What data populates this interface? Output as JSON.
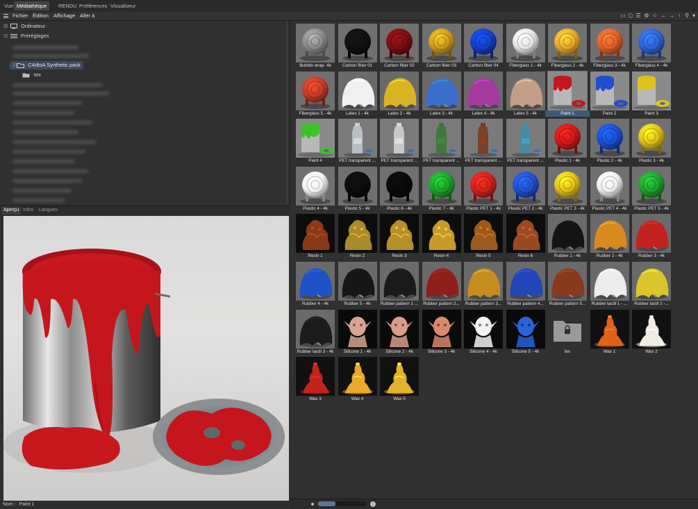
{
  "tabs": [
    {
      "label": "Vue"
    },
    {
      "label": "Médiathèque"
    },
    {
      "label": "RENDU"
    },
    {
      "label": "Préférences"
    },
    {
      "label": "Visualiseur"
    }
  ],
  "menu": [
    "Fichier",
    "Édition",
    "Affichage",
    "Aller à"
  ],
  "toolbar_icons": [
    "screen-icon",
    "star-outline-icon",
    "list-icon",
    "gear-icon",
    "star-icon",
    "arrow-left-icon",
    "arrow-right-icon",
    "arrow-up-icon",
    "search-icon",
    "filter-icon"
  ],
  "tree": {
    "computer": "Ordinateur",
    "presets": "Préréglages",
    "pack": "C4dtoA Synthetic pack",
    "tex": "tex"
  },
  "preview_tabs": [
    "Aperçu",
    "Infos",
    "Langues"
  ],
  "status": {
    "name_label": "Nom :",
    "name_value": "Paint 1"
  },
  "colors": {
    "selection": "#3f5a78",
    "panel_bg": "#303030",
    "paint_red": "#c4161c"
  },
  "grid": [
    {
      "label": "Bubble wrap- 4k",
      "kind": "sphere",
      "color": "#8a8a8a"
    },
    {
      "label": "Carbon fiber 01",
      "kind": "sphere",
      "color": "#111111"
    },
    {
      "label": "Carbon fiber 02",
      "kind": "sphere",
      "color": "#7a0f12"
    },
    {
      "label": "Carbon fiber 03",
      "kind": "sphere",
      "color": "#c99a1e"
    },
    {
      "label": "Carbon fiber 04",
      "kind": "sphere",
      "color": "#1240c8"
    },
    {
      "label": "Fiberglass 1 - 4k",
      "kind": "sphere",
      "color": "#e6e6e6"
    },
    {
      "label": "Fiberglass 2 - 4k",
      "kind": "sphere",
      "color": "#e8a72a"
    },
    {
      "label": "Fiberglass 3 - 4k",
      "kind": "sphere",
      "color": "#e0612a"
    },
    {
      "label": "Fiberglass 4 - 4k",
      "kind": "sphere",
      "color": "#2f63d6"
    },
    {
      "label": "Fiberglass 5 - 4k",
      "kind": "sphere",
      "color": "#c63b27"
    },
    {
      "label": "Latex 1 - 4k",
      "kind": "cloth",
      "color": "#f0f0f0"
    },
    {
      "label": "Latex 2 - 4k",
      "kind": "cloth",
      "color": "#d9b324"
    },
    {
      "label": "Latex 3 - 4k",
      "kind": "cloth",
      "color": "#3b6fce"
    },
    {
      "label": "Latex 4 - 4k",
      "kind": "cloth",
      "color": "#a5399e"
    },
    {
      "label": "Latex 5 - 4k",
      "kind": "cloth",
      "color": "#c59d86"
    },
    {
      "label": "Paint 1",
      "kind": "can",
      "color": "#c4161c",
      "selected": true
    },
    {
      "label": "Paint 2",
      "kind": "can",
      "color": "#1f4fd0"
    },
    {
      "label": "Paint 3",
      "kind": "can",
      "color": "#e1c21c"
    },
    {
      "label": "Paint 4",
      "kind": "can",
      "color": "#3ec22a"
    },
    {
      "label": "PET transparent ...",
      "kind": "bottle",
      "color": "#cfd8dc"
    },
    {
      "label": "PET transparent ...",
      "kind": "bottle",
      "color": "#dfe4e6"
    },
    {
      "label": "PET transparent ...",
      "kind": "bottle",
      "color": "#2f7a2a"
    },
    {
      "label": "PET transparent ...",
      "kind": "bottle",
      "color": "#7a3010"
    },
    {
      "label": "PET transparent ...",
      "kind": "bottle",
      "color": "#3a8fb0"
    },
    {
      "label": "Plastic 1 - 4k",
      "kind": "sphere",
      "color": "#d11a1a"
    },
    {
      "label": "Plastic 2 - 4k",
      "kind": "sphere",
      "color": "#1b4fd4"
    },
    {
      "label": "Plastic 3 - 4k",
      "kind": "sphere",
      "color": "#e0c018"
    },
    {
      "label": "Plastic 4 - 4k",
      "kind": "sphere",
      "color": "#f2f2f2"
    },
    {
      "label": "Plastic 5 - 4k",
      "kind": "sphere",
      "color": "#0d0d0d"
    },
    {
      "label": "Plastic 6 - 4k",
      "kind": "sphere",
      "color": "#0a0a0a"
    },
    {
      "label": "Plastic 7 - 4k",
      "kind": "sphere",
      "color": "#1ea32a"
    },
    {
      "label": "Plastic PET 1 - 4k",
      "kind": "sphere",
      "color": "#d4231b"
    },
    {
      "label": "Plastic PET 2 - 4k",
      "kind": "sphere",
      "color": "#2250d0"
    },
    {
      "label": "Plastic PET 3 - 4k",
      "kind": "sphere",
      "color": "#e2bd19"
    },
    {
      "label": "Plastic PET 4 - 4k",
      "kind": "sphere",
      "color": "#f0f0f0"
    },
    {
      "label": "Plastic PET 5 - 4k",
      "kind": "sphere",
      "color": "#1fa22d"
    },
    {
      "label": "Resin 1",
      "kind": "statue",
      "color": "#8a3a18"
    },
    {
      "label": "Resin 2",
      "kind": "statue",
      "color": "#a88a2a"
    },
    {
      "label": "Resin 3",
      "kind": "statue",
      "color": "#b48f2a"
    },
    {
      "label": "Resin 4",
      "kind": "statue",
      "color": "#c79a2c"
    },
    {
      "label": "Resin 5",
      "kind": "statue",
      "color": "#9c5a1c"
    },
    {
      "label": "Resin 6",
      "kind": "statue",
      "color": "#9a4a22"
    },
    {
      "label": "Rubber 1 - 4k",
      "kind": "cloth",
      "color": "#141414"
    },
    {
      "label": "Rubber 2 - 4k",
      "kind": "cloth",
      "color": "#d98a1e"
    },
    {
      "label": "Rubber 3 - 4k",
      "kind": "cloth",
      "color": "#c4221e"
    },
    {
      "label": "Rubber 4 - 4k",
      "kind": "cloth",
      "color": "#1f52c9"
    },
    {
      "label": "Rubber 5 - 4k",
      "kind": "cloth",
      "color": "#161616"
    },
    {
      "label": "Rubber pattern 1 ...",
      "kind": "cloth",
      "color": "#1a1a1a"
    },
    {
      "label": "Rubber pattern 2...",
      "kind": "cloth",
      "color": "#8e1f1a"
    },
    {
      "label": "Rubber pattern 3...",
      "kind": "cloth",
      "color": "#c58c1f"
    },
    {
      "label": "Rubber pattern 4...",
      "kind": "cloth",
      "color": "#2146b8"
    },
    {
      "label": "Rubber pattern 5...",
      "kind": "cloth",
      "color": "#8a3a1c"
    },
    {
      "label": "Rubber tactil 1 - ...",
      "kind": "cloth",
      "color": "#ececec"
    },
    {
      "label": "Rubber tactil 2 -...",
      "kind": "cloth",
      "color": "#d9c62a"
    },
    {
      "label": "Rubber tactil 3 - 4k",
      "kind": "cloth",
      "color": "#1c1c1c"
    },
    {
      "label": "Silicone 1 - 4k",
      "kind": "bust",
      "color": "#d9a592"
    },
    {
      "label": "Silicone 2 - 4k",
      "kind": "bust",
      "color": "#d7a08a"
    },
    {
      "label": "Silicone 3 - 4k",
      "kind": "bust",
      "color": "#d98a6c"
    },
    {
      "label": "Silicone 4 - 4k",
      "kind": "bust",
      "color": "#f2f2f2"
    },
    {
      "label": "Silicone 5 - 4k",
      "kind": "bust",
      "color": "#2a63d8"
    },
    {
      "label": "tex",
      "kind": "folder",
      "color": "#9a9a9a"
    },
    {
      "label": "Wax 1",
      "kind": "wax",
      "color": "#e0621a"
    },
    {
      "label": "Wax 2",
      "kind": "wax",
      "color": "#f0ece4"
    },
    {
      "label": "Wax 3",
      "kind": "wax",
      "color": "#c3241a"
    },
    {
      "label": "Wax 4",
      "kind": "wax",
      "color": "#e9a92a"
    },
    {
      "label": "Wax 5",
      "kind": "wax",
      "color": "#e2b32c"
    }
  ]
}
